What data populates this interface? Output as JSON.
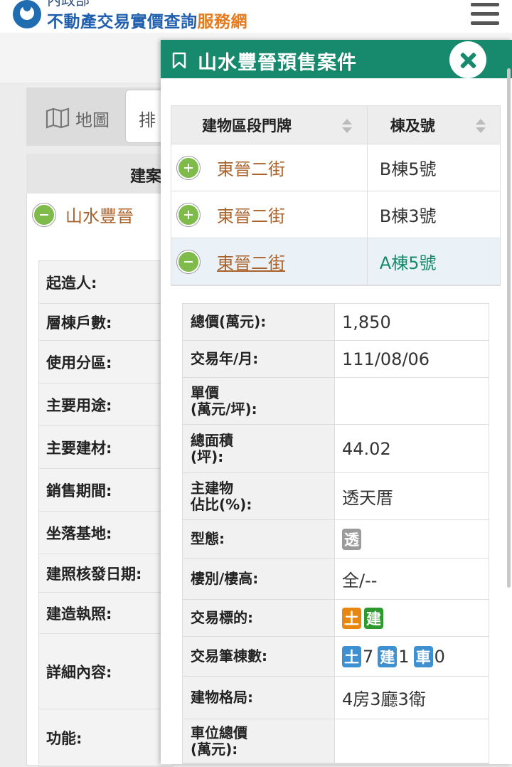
{
  "header": {
    "ministry": "內政部",
    "title_main": "不動產交易實價查詢",
    "title_accent": "服務網"
  },
  "background": {
    "map_label": "地圖",
    "sort_label": "排",
    "column_header": "建案",
    "project_name": "山水豐晉",
    "labels": [
      "起造人:",
      "層棟戶數:",
      "使用分區:",
      "主要用途:",
      "主要建材:",
      "銷售期間:",
      "坐落基地:",
      "建照核發日期:",
      "建造執照:",
      "詳細內容:",
      "功能:"
    ]
  },
  "modal": {
    "title": "山水豐晉預售案件",
    "columns": [
      "建物區段門牌",
      "棟及號"
    ],
    "units": [
      {
        "address": "東晉二街",
        "unit": "B棟5號",
        "expanded": false
      },
      {
        "address": "東晉二街",
        "unit": "B棟3號",
        "expanded": false
      },
      {
        "address": "東晉二街",
        "unit": "A棟5號",
        "expanded": true
      }
    ],
    "details": [
      {
        "label": "總價(萬元):",
        "value": "1,850"
      },
      {
        "label": "交易年/月:",
        "value": "111/08/06"
      },
      {
        "label": "單價\n(萬元/坪):",
        "value": ""
      },
      {
        "label": "總面積\n(坪):",
        "value": "44.02"
      },
      {
        "label": "主建物\n佔比(%):",
        "value": "透天厝"
      },
      {
        "label": "型態:",
        "tag": "透"
      },
      {
        "label": "樓別/樓高:",
        "value": "全/--"
      },
      {
        "label": "交易標的:",
        "tags": [
          "土",
          "建"
        ]
      },
      {
        "label": "交易筆棟數:",
        "counts": [
          {
            "tag": "土",
            "n": "7"
          },
          {
            "tag": "建",
            "n": "1"
          },
          {
            "tag": "車",
            "n": "0"
          }
        ]
      },
      {
        "label": "建物格局:",
        "value": "4房3廳3衛"
      },
      {
        "label": "車位總價\n(萬元):",
        "value": ""
      }
    ]
  },
  "colors": {
    "accent_green": "#178a6e",
    "link_brown": "#a9622c",
    "tag_orange": "#e8870f",
    "tag_green": "#2e9a2e",
    "tag_blue": "#3f90d0",
    "tag_gray": "#9b9b9b"
  }
}
